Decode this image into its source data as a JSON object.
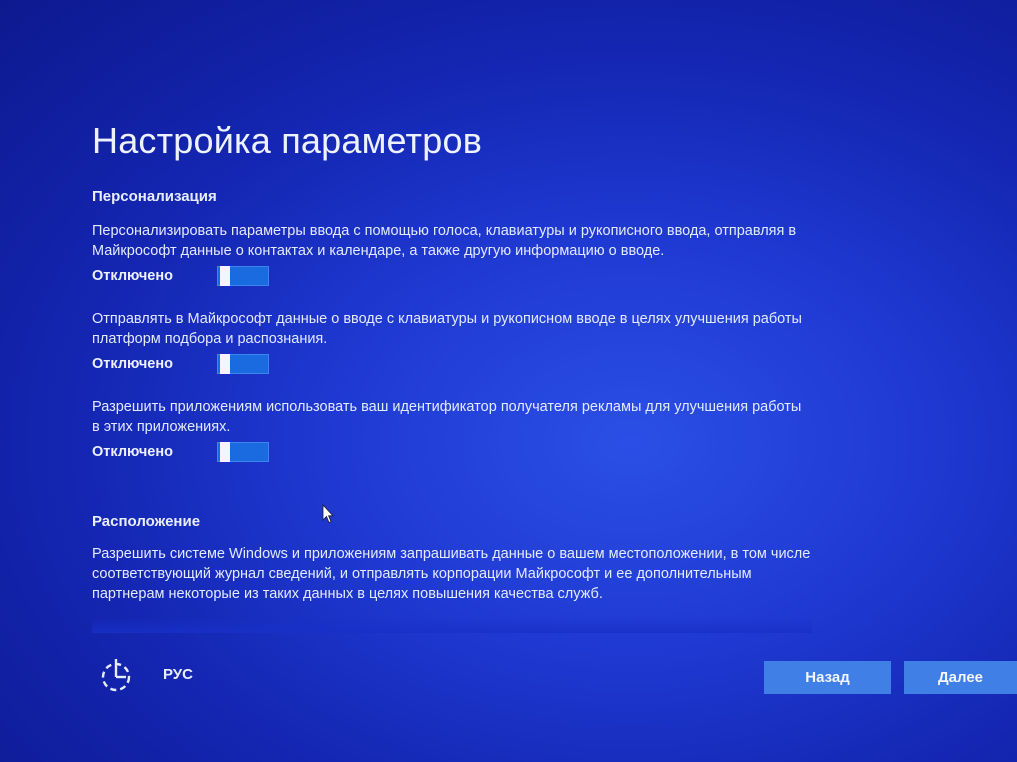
{
  "title": "Настройка параметров",
  "personalization": {
    "heading": "Персонализация",
    "settings": [
      {
        "description": "Персонализировать параметры ввода с помощью голоса, клавиатуры и рукописного ввода, отправляя в Майкрософт данные о контактах и календаре, а также другую информацию о вводе.",
        "state_label": "Отключено",
        "enabled": false
      },
      {
        "description": "Отправлять в Майкрософт данные о вводе с клавиатуры и рукописном вводе в целях улучшения работы платформ подбора и распознания.",
        "state_label": "Отключено",
        "enabled": false
      },
      {
        "description": "Разрешить приложениям использовать ваш идентификатор получателя рекламы для улучшения работы в этих приложениях.",
        "state_label": "Отключено",
        "enabled": false
      }
    ]
  },
  "location": {
    "heading": "Расположение",
    "description": "Разрешить системе Windows и приложениям запрашивать данные о вашем местоположении, в том числе соответствующий журнал сведений, и отправлять корпорации Майкрософт и ее дополнительным партнерам некоторые из таких данных в целях повышения качества служб."
  },
  "footer": {
    "accessibility_icon": "ease-of-access-icon",
    "language": "РУС",
    "back_label": "Назад",
    "next_label": "Далее"
  },
  "colors": {
    "background": "#1e38d0",
    "toggle_fill": "#1a6be0",
    "button_fill": "#3f7fe6"
  }
}
